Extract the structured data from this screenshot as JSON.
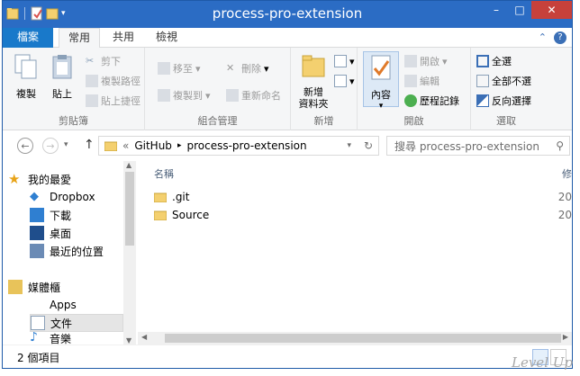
{
  "window": {
    "title": "process-pro-extension"
  },
  "ribbon_tabs": [
    "檔案",
    "常用",
    "共用",
    "檢視"
  ],
  "ribbon": {
    "clipboard": {
      "label": "剪貼簿",
      "copy": "複製",
      "paste": "貼上",
      "cut": "剪下",
      "copy_path": "複製路徑",
      "paste_shortcut": "貼上捷徑"
    },
    "organize": {
      "label": "組合管理",
      "move_to": "移至",
      "delete": "刪除",
      "copy_to": "複製到",
      "rename": "重新命名"
    },
    "new": {
      "label": "新增",
      "new_folder": "新增\n資料夾"
    },
    "open": {
      "label": "開啟",
      "properties": "內容",
      "open": "開啟",
      "edit": "編輯",
      "history": "歷程記錄"
    },
    "select": {
      "label": "選取",
      "select_all": "全選",
      "select_none": "全部不選",
      "invert": "反向選擇"
    }
  },
  "address": {
    "crumbs": [
      "GitHub",
      "process-pro-extension"
    ],
    "search_placeholder": "搜尋 process-pro-extension"
  },
  "nav": {
    "favorites": "我的最愛",
    "items": [
      "Dropbox",
      "下載",
      "桌面",
      "最近的位置"
    ],
    "libraries": "媒體櫃",
    "lib_items": [
      "Apps",
      "文件",
      "音樂"
    ]
  },
  "files": {
    "column_name": "名稱",
    "column_date_partial": "修",
    "rows": [
      {
        "name": ".git",
        "date_partial": "20"
      },
      {
        "name": "Source",
        "date_partial": "20"
      }
    ]
  },
  "status": {
    "count": "2 個項目"
  },
  "watermark": "Level Up",
  "colors": {
    "titlebar": "#2b6cc4",
    "file_tab": "#1979ca",
    "close": "#c7413b"
  }
}
